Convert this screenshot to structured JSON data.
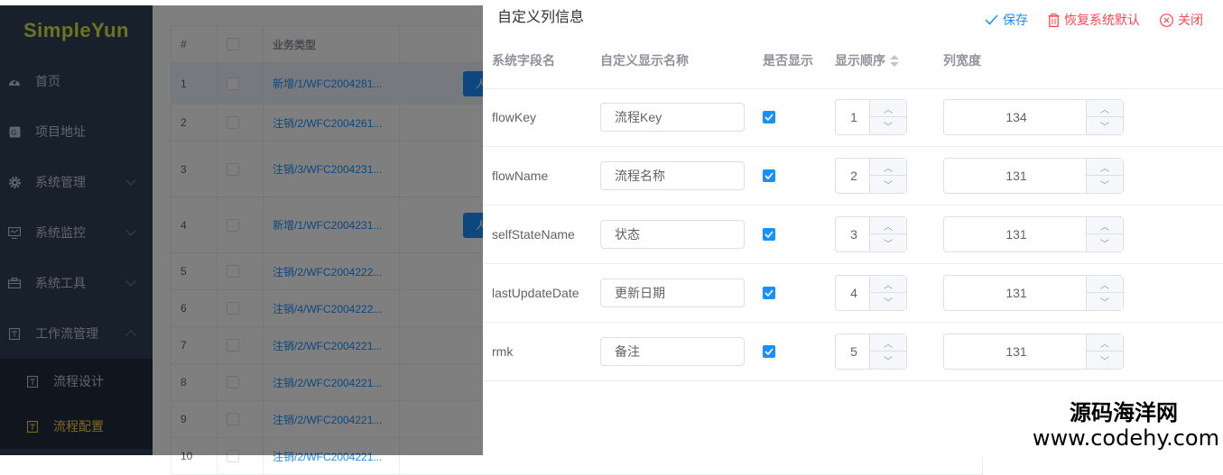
{
  "sidebar": {
    "logo": "SimpleYun",
    "items": [
      {
        "label": "首页",
        "icon": "dashboard-icon"
      },
      {
        "label": "项目地址",
        "icon": "guide-icon"
      },
      {
        "label": "系统管理",
        "icon": "gear-icon"
      },
      {
        "label": "系统监控",
        "icon": "monitor-icon"
      },
      {
        "label": "系统工具",
        "icon": "tool-icon"
      },
      {
        "label": "工作流管理",
        "icon": "workflow-icon"
      }
    ],
    "submenu": [
      {
        "label": "流程设计",
        "icon": "form-icon"
      },
      {
        "label": "流程配置",
        "icon": "form-icon",
        "active": true
      }
    ]
  },
  "background_table": {
    "headers": [
      "#",
      "",
      "业务类型"
    ],
    "rows": [
      {
        "idx": "1",
        "type": "新增/1/WFC2004281..."
      },
      {
        "idx": "2",
        "type": "注销/2/WFC2004261..."
      },
      {
        "idx": "3",
        "type": "注销/3/WFC2004231..."
      },
      {
        "idx": "4",
        "type": "新增/1/WFC2004231..."
      },
      {
        "idx": "5",
        "type": "注销/2/WFC2004222..."
      },
      {
        "idx": "6",
        "type": "注销/4/WFC2004222..."
      },
      {
        "idx": "7",
        "type": "注销/2/WFC2004221..."
      },
      {
        "idx": "8",
        "type": "注销/2/WFC2004221..."
      },
      {
        "idx": "9",
        "type": "注销/2/WFC2004221..."
      },
      {
        "idx": "10",
        "type": "注销/2/WFC2004221..."
      }
    ],
    "button_label": "人"
  },
  "drawer": {
    "title": "自定义列信息",
    "actions": {
      "save": "保存",
      "reset": "恢复系统默认",
      "close": "关闭"
    },
    "headers": {
      "field": "系统字段名",
      "display_name": "自定义显示名称",
      "visible": "是否显示",
      "order": "显示顺序",
      "width": "列宽度"
    },
    "rows": [
      {
        "field": "flowKey",
        "display_name": "流程Key",
        "visible": true,
        "order": "1",
        "width": "134"
      },
      {
        "field": "flowName",
        "display_name": "流程名称",
        "visible": true,
        "order": "2",
        "width": "131"
      },
      {
        "field": "selfStateName",
        "display_name": "状态",
        "visible": true,
        "order": "3",
        "width": "131"
      },
      {
        "field": "lastUpdateDate",
        "display_name": "更新日期",
        "visible": true,
        "order": "4",
        "width": "131"
      },
      {
        "field": "rmk",
        "display_name": "备注",
        "visible": true,
        "order": "5",
        "width": "131"
      }
    ]
  },
  "watermark": {
    "cn": "源码海洋网",
    "en": "www.codehy.com"
  },
  "colors": {
    "accent": "#1890ff",
    "danger": "#ff4949",
    "sidebar_bg": "#304156",
    "active_menu": "#ffd04b"
  }
}
